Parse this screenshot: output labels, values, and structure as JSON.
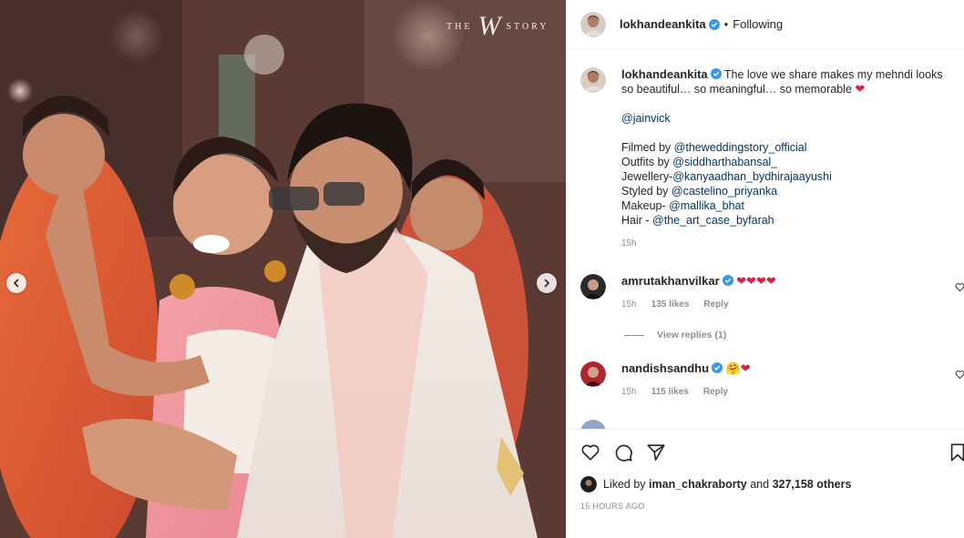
{
  "photo": {
    "watermark": {
      "pre": "THE",
      "mark": "W",
      "post": "STORY"
    },
    "prev_icon": "chevron-left-icon",
    "next_icon": "chevron-right-icon"
  },
  "header": {
    "username": "lokhandeankita",
    "separator": "•",
    "follow_state": "Following"
  },
  "caption": {
    "username": "lokhandeankita",
    "text": "The love we share makes my mehndi looks so beautiful… so meaningful… so memorable",
    "emoji": "❤",
    "mention": "@jainvick",
    "credits": [
      {
        "label": "Filmed by ",
        "handle": "@theweddingstory_official"
      },
      {
        "label": "Outfits by ",
        "handle": "@siddharthabansal_"
      },
      {
        "label": "Jewellery-",
        "handle": "@kanyaadhan_bydhirajaayushi"
      },
      {
        "label": "Styled by ",
        "handle": "@castelino_priyanka"
      },
      {
        "label": "Makeup- ",
        "handle": "@mallika_bhat"
      },
      {
        "label": "Hair - ",
        "handle": "@the_art_case_byfarah"
      }
    ],
    "time": "15h"
  },
  "comments": [
    {
      "username": "amrutakhanvilkar",
      "text": "❤❤❤❤",
      "time": "15h",
      "likes": "135 likes",
      "reply": "Reply"
    },
    {
      "username": "nandishsandhu",
      "text": "🤗❤",
      "time": "15h",
      "likes": "115 likes",
      "reply": "Reply"
    }
  ],
  "view_replies": "View replies (1)",
  "actions": {
    "liked_by_prefix": "Liked by ",
    "liked_by_user": "iman_chakraborty",
    "liked_by_mid": " and ",
    "liked_by_count": "327,158 others",
    "timestamp": "15 HOURS AGO"
  },
  "colors": {
    "link": "#00376b",
    "verified": "#3897f0",
    "heart": "#e21d3a",
    "muted": "#8e8e8e"
  }
}
